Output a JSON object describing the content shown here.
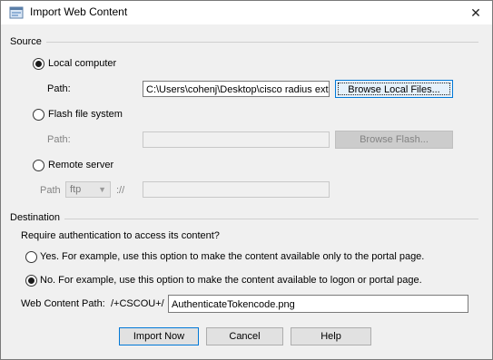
{
  "window": {
    "title": "Import Web Content",
    "close_glyph": "✕"
  },
  "source": {
    "group_label": "Source",
    "local": {
      "label": "Local computer",
      "selected": true,
      "path_label": "Path:",
      "path_value": "C:\\Users\\cohenj\\Desktop\\cisco radius ext",
      "browse_label": "Browse Local Files..."
    },
    "flash": {
      "label": "Flash file system",
      "selected": false,
      "path_label": "Path:",
      "path_value": "",
      "browse_label": "Browse Flash..."
    },
    "remote": {
      "label": "Remote server",
      "selected": false,
      "path_label": "Path",
      "protocol": "ftp",
      "separator": "://",
      "path_value": ""
    }
  },
  "destination": {
    "group_label": "Destination",
    "question": "Require authentication to access its content?",
    "yes_label": "Yes. For example, use this option to make the content available only to the portal page.",
    "yes_selected": false,
    "no_label": "No. For example, use this option to make the content available to logon or portal page.",
    "no_selected": true,
    "web_path_label": "Web Content Path:",
    "web_path_prefix": "/+CSCOU+/",
    "web_path_value": "AuthenticateTokencode.png"
  },
  "buttons": {
    "import": "Import Now",
    "cancel": "Cancel",
    "help": "Help"
  },
  "colors": {
    "focus_border": "#0078d7",
    "dialog_bg": "#f0f0f0"
  }
}
